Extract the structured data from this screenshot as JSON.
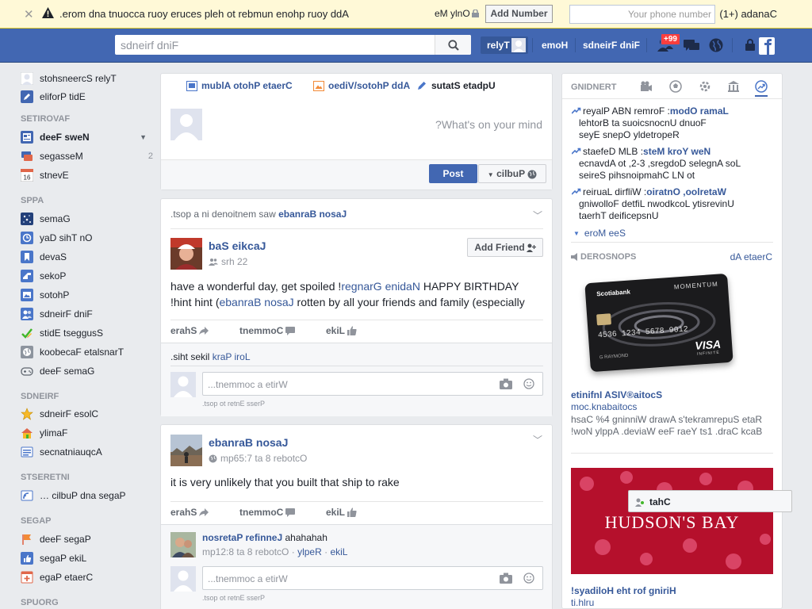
{
  "notice": {
    "message": ".erom dna tnuocca ruoy eruces pleh ot rebmun enohp ruoy ddA",
    "privacy": "eM ylnO",
    "add_button": "Add Number",
    "phone_placeholder": "Your phone number",
    "country": "(1+) adanaC"
  },
  "header": {
    "search_placeholder": "sdneirf dniF",
    "profile_name": "relyT",
    "home": "emoH",
    "find_friends": "sdneirF dniF",
    "notif_count": "+99",
    "accent": "#4267b2"
  },
  "left": {
    "profile": "stohsneercS relyT",
    "edit_profile": "eliforP tidE",
    "favorites_head": "SETIROVAF",
    "favorites": [
      {
        "label": "deeF sweN",
        "icon": "news-feed-icon"
      },
      {
        "label": "segasseM",
        "icon": "messages-icon",
        "count": "2"
      },
      {
        "label": "stnevE",
        "icon": "calendar-icon"
      }
    ],
    "apps_head": "SPPA",
    "apps": [
      {
        "label": "semaG",
        "icon": "games-icon"
      },
      {
        "label": "yaD sihT nO",
        "icon": "on-this-day-icon"
      },
      {
        "label": "devaS",
        "icon": "saved-icon"
      },
      {
        "label": "sekoP",
        "icon": "pokes-icon"
      },
      {
        "label": "sotohP",
        "icon": "photos-icon"
      },
      {
        "label": "sdneirF dniF",
        "icon": "find-friends-icon"
      },
      {
        "label": "stidE tseggusS",
        "icon": "suggest-edits-icon"
      },
      {
        "label": "koobecaF etalsnarT",
        "icon": "translate-icon"
      },
      {
        "label": "deeF semaG",
        "icon": "games-feed-icon"
      }
    ],
    "friends_head": "SDNEIRF",
    "friends": [
      {
        "label": "sdneirF esolC",
        "icon": "close-friends-icon"
      },
      {
        "label": "ylimaF",
        "icon": "family-icon"
      },
      {
        "label": "secnatniauqcA",
        "icon": "acquaintances-icon"
      }
    ],
    "interests_head": "STSERETNI",
    "interests": [
      {
        "label": "… cilbuP dna segaP",
        "icon": "pages-feed-icon"
      }
    ],
    "pages_head": "SEGAP",
    "pages": [
      {
        "label": "deeF segaP",
        "icon": "pages-feed-flag-icon"
      },
      {
        "label": "segaP ekiL",
        "icon": "like-pages-icon"
      },
      {
        "label": "egaP etaerC",
        "icon": "create-page-icon"
      }
    ],
    "groups_head": "SPUORG"
  },
  "composer": {
    "tab_status": "sutatS etadpU",
    "tab_photo": "oediV/sotohP ddA",
    "tab_album": "mublA otohP etaerC",
    "placeholder": "?What's on your mind",
    "post": "Post",
    "audience": "cilbuP"
  },
  "post1": {
    "story_tail": ".tsop a ni denoitnem saw",
    "story_name": "ebanraB nosaJ",
    "author": "baS eikcaJ",
    "time": "srh 22",
    "add_friend": "Add Friend",
    "line1_a": "have a wonderful day, get spoiled !",
    "line1_tag": "regnarG enidaN",
    "line1_b": " HAPPY BIRTHDAY",
    "line2_a": "!hint hint (",
    "line2_tag": "ebanraB nosaJ",
    "line2_b": " rotten by all your friends and family (especially",
    "share": "erahS",
    "comment": "tnemmoC",
    "like": "ekiL",
    "likes_text": ".siht sekil",
    "likes_name": "kraP iroL",
    "comment_placeholder": "...tnemmoc a etirW",
    "enter_hint": ".tsop ot retnE sserP"
  },
  "post2": {
    "author": "ebanraB nosaJ",
    "time": "mp65:7 ta 8 rebotcO",
    "text": "it is very unlikely that you built that ship to rake",
    "share": "erahS",
    "comment": "tnemmoC",
    "like": "ekiL",
    "c_name": "nosretaP refinneJ",
    "c_text": "ahahahah",
    "c_time": "mp12:8 ta 8 rebotcO",
    "c_reply": "ylpeR",
    "c_like": "ekiL",
    "comment_placeholder": "...tnemmoc a etirW",
    "enter_hint": ".tsop ot retnE sserP"
  },
  "trending": {
    "head": "GNIDNERT",
    "items": [
      {
        "title": "modO ramaL",
        "line1": "reyalP ABN remroF :",
        "line2": "lehtorB ta suoicsnocnU dnuoF",
        "line3": "seyE snepO yldetropeR"
      },
      {
        "title": "steM kroY weN",
        "line1": "staefeD MLB :",
        "line2": "ecnavdA ot ,2-3 ,sregdoD selegnA soL",
        "line3": "seireS pihsnoipmahC LN ot"
      },
      {
        "title": "oiratnO ,oolretaW",
        "line1": "reiruaL dirfliW :",
        "line2": "gniwolloF detfiL nwodkcoL ytisrevinU",
        "line3": "taerhT deificepsnU"
      }
    ],
    "see_more": "eroM eeS"
  },
  "sponsored": {
    "head": "DEROSNOPS",
    "create_ad": "dA etaerC",
    "ad1_title": "etinifnI ASIV®aitocS",
    "ad1_url": "moc.knabaitocs",
    "ad1_body1": "hsaC %4 gninniW drawA s'tekramrepuS etaR",
    "ad1_body2": "!woN ylppA .deviaW eeF raeY ts1 .draC kcaB",
    "card_bank": "Scotiabank",
    "card_product": "MOMENTUM",
    "card_number": "4536 1234 5678 9012",
    "card_holder": "G RAYMOND",
    "card_network": "VISA",
    "card_tier": "INFINITE",
    "ad2_banner": "HUDSON'S BAY",
    "ad2_title": "!syadiloH eht rof gniriH",
    "ad2_url": "ti.hlru"
  },
  "chat": {
    "label": "tahC"
  }
}
